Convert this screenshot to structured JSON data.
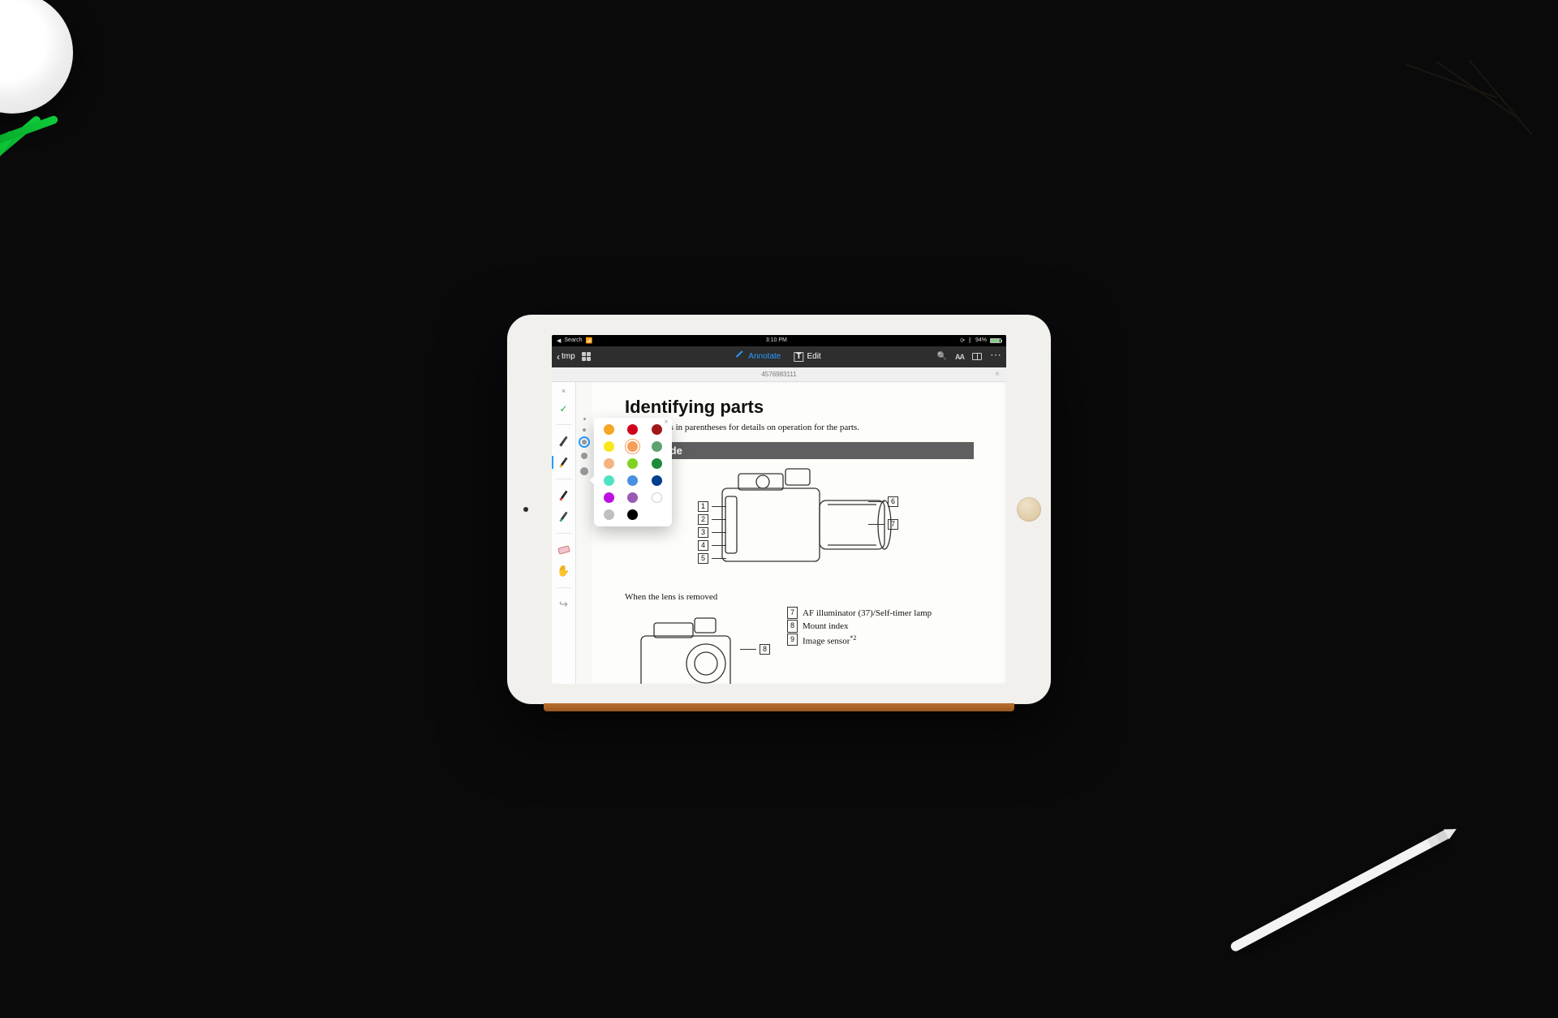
{
  "status": {
    "left_label": "Search",
    "time": "3:10 PM",
    "battery": "94%"
  },
  "toolbar": {
    "back_label": "tmp",
    "mode_annotate": "Annotate",
    "mode_edit": "Edit",
    "font_toggle": "AA"
  },
  "doc_strip": {
    "filename": "4576983111"
  },
  "sidebar": {
    "close": "×",
    "check": "✓"
  },
  "colors": [
    "#f5a623",
    "#d0021b",
    "#a0191a",
    "#f8e71c",
    "#f59f5b",
    "#5da36f",
    "#f6b37f",
    "#7ed321",
    "#1d8b3a",
    "#50e3c2",
    "#4a90e2",
    "#003f8e",
    "#bd10e0",
    "#9b59b6",
    "#ffffff",
    "#bfbfbf",
    "#000000"
  ],
  "selected_color_index": 4,
  "document": {
    "title": "Identifying parts",
    "subtitle": "See the pages in parentheses for details on operation for the parts.",
    "section": "Front side",
    "callouts_left": [
      "1",
      "2",
      "3",
      "4",
      "5"
    ],
    "callouts_right": [
      "6",
      "7"
    ],
    "subhead": "When the lens is removed",
    "legend": [
      {
        "n": "7",
        "txt": "AF illuminator (37)/Self-timer lamp"
      },
      {
        "n": "8",
        "txt": "Mount index"
      },
      {
        "n": "9",
        "txt": "Image sensor*²"
      }
    ],
    "small_callout": "8"
  }
}
